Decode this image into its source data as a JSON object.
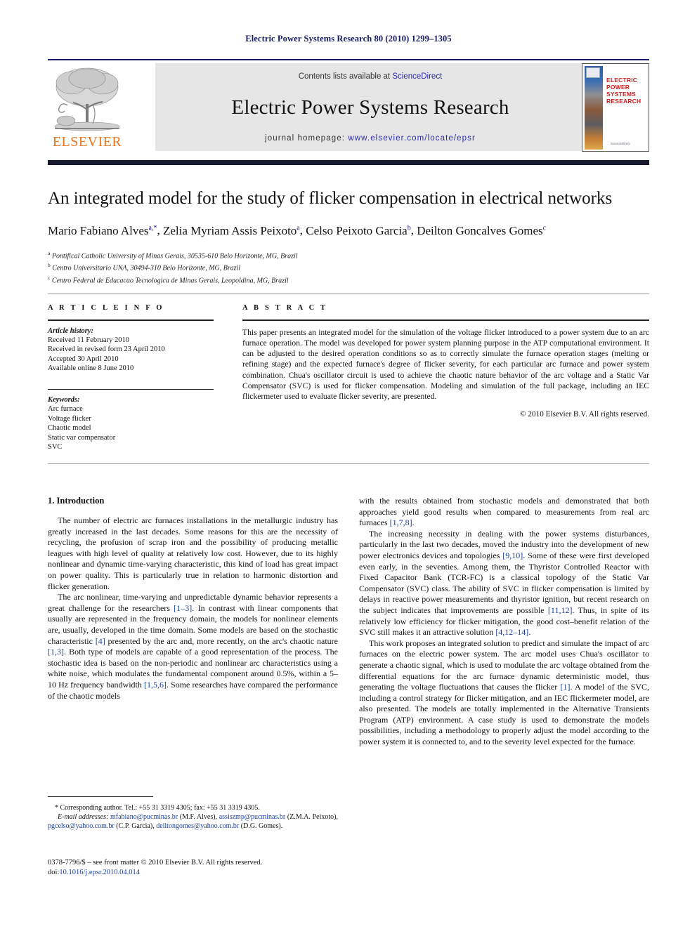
{
  "running_head": "Electric Power Systems Research 80 (2010) 1299–1305",
  "banner": {
    "contents_prefix": "Contents lists available at ",
    "sciencedirect": "ScienceDirect",
    "journal_title": "Electric Power Systems Research",
    "homepage_prefix": "journal homepage: ",
    "homepage_url": "www.elsevier.com/locate/epsr",
    "publisher_logo_text": "ELSEVIER",
    "publisher_logo_color": "#E87722",
    "link_color": "#2b2bb0",
    "cover": {
      "title_line1": "ELECTRIC POWER",
      "title_line2": "SYSTEMS RESEARCH",
      "title_color": "#cc2020",
      "footer": "ScienceDirect"
    }
  },
  "article": {
    "title": "An integrated model for the study of flicker compensation in electrical networks",
    "authors": [
      {
        "name": "Mario Fabiano Alves",
        "marks": "a,*"
      },
      {
        "name": "Zelia Myriam Assis Peixoto",
        "marks": "a"
      },
      {
        "name": "Celso Peixoto Garcia",
        "marks": "b"
      },
      {
        "name": "Deilton Goncalves Gomes",
        "marks": "c"
      }
    ],
    "affiliations": [
      {
        "mark": "a",
        "text": "Pontifical Catholic University of Minas Gerais, 30535-610 Belo Horizonte, MG, Brazil"
      },
      {
        "mark": "b",
        "text": "Centro Universitario UNA, 30494-310 Belo Horizonte, MG, Brazil"
      },
      {
        "mark": "c",
        "text": "Centro Federal de Educacao Tecnologica de Minas Gerais, Leopoldina, MG, Brazil"
      }
    ]
  },
  "article_info": {
    "label": "A R T I C L E    I N F O",
    "history_heading": "Article history:",
    "history": [
      "Received 11 February 2010",
      "Received in revised form 23 April 2010",
      "Accepted 30 April 2010",
      "Available online 8 June 2010"
    ],
    "keywords_heading": "Keywords:",
    "keywords": [
      "Arc furnace",
      "Voltage flicker",
      "Chaotic model",
      "Static var compensator",
      "SVC"
    ]
  },
  "abstract": {
    "label": "A B S T R A C T",
    "text": "This paper presents an integrated model for the simulation of the voltage flicker introduced to a power system due to an arc furnace operation. The model was developed for power system planning purpose in the ATP computational environment. It can be adjusted to the desired operation conditions so as to correctly simulate the furnace operation stages (melting or refining stage) and the expected furnace's degree of flicker severity, for each particular arc furnace and power system combination. Chua's oscillator circuit is used to achieve the chaotic nature behavior of the arc voltage and a Static Var Compensator (SVC) is used for flicker compensation. Modeling and simulation of the full package, including an IEC flickermeter used to evaluate flicker severity, are presented.",
    "copyright": "© 2010 Elsevier B.V. All rights reserved."
  },
  "body": {
    "section1_heading": "1.  Introduction",
    "left_paragraphs": [
      "The number of electric arc furnaces installations in the metallurgic industry has greatly increased in the last decades. Some reasons for this are the necessity of recycling, the profusion of scrap iron and the possibility of producing metallic leagues with high level of quality at relatively low cost. However, due to its highly nonlinear and dynamic time-varying characteristic, this kind of load has great impact on power quality. This is particularly true in relation to harmonic distortion and flicker generation."
    ],
    "left_paragraph2_parts": [
      "The arc nonlinear, time-varying and unpredictable dynamic behavior represents a great challenge for the researchers ",
      "[1–3]",
      ". In contrast with linear components that usually are represented in the frequency domain, the models for nonlinear elements are, usually, developed in the time domain. Some models are based on the stochastic characteristic ",
      "[4]",
      " presented by the arc and, more recently, on the arc's chaotic nature ",
      "[1,3]",
      ". Both type of models are capable of a good representation of the process. The stochastic idea is based on the non-periodic and nonlinear arc characteristics using a white noise, which modulates the fundamental component around 0.5%, within a 5–10 Hz frequency bandwidth ",
      "[1,5,6]",
      ". Some researches have compared the performance of the chaotic models"
    ],
    "right_paragraph1_parts": [
      "with the results obtained from stochastic models and demonstrated that both approaches yield good results when compared to measurements from real arc furnaces ",
      "[1,7,8]",
      "."
    ],
    "right_paragraph2_parts": [
      "The increasing necessity in dealing with the power systems disturbances, particularly in the last two decades, moved the industry into the development of new power electronics devices and topologies ",
      "[9,10]",
      ". Some of these were first developed even early, in the seventies. Among them, the Thyristor Controlled Reactor with Fixed Capacitor Bank (TCR-FC) is a classical topology of the Static Var Compensator (SVC) class. The ability of SVC in flicker compensation is limited by delays in reactive power measurements and thyristor ignition, but recent research on the subject indicates that improvements are possible ",
      "[11,12]",
      ". Thus, in spite of its relatively low efficiency for flicker mitigation, the good cost–benefit relation of the SVC still makes it an attractive solution ",
      "[4,12–14]",
      "."
    ],
    "right_paragraph3_parts": [
      "This work proposes an integrated solution to predict and simulate the impact of arc furnaces on the electric power system. The arc model uses Chua's oscillator to generate a chaotic signal, which is used to modulate the arc voltage obtained from the differential equations for the arc furnace dynamic deterministic model, thus generating the voltage fluctuations that causes the flicker ",
      "[1]",
      ". A model of the SVC, including a control strategy for flicker mitigation, and an IEC flickermeter model, are also presented. The models are totally implemented in the Alternative Transients Program (ATP) environment. A case study is used to demonstrate the models possibilities, including a methodology to properly adjust the model according to the power system it is connected to, and to the severity level expected for the furnace."
    ]
  },
  "footnotes": {
    "corresponding": "* Corresponding author. Tel.: +55 31 3319 4305; fax: +55 31 3319 4305.",
    "email_label": "E-mail addresses:",
    "emails": [
      {
        "address": "mfabiano@pucminas.br",
        "owner": "(M.F. Alves)"
      },
      {
        "address": "assiszmp@pucminas.br",
        "owner": "(Z.M.A. Peixoto)"
      },
      {
        "address": "pgcelso@yahoo.com.br",
        "owner": "(C.P. Garcia)"
      },
      {
        "address": "deiltongomes@yahoo.com.br",
        "owner": "(D.G. Gomes)"
      }
    ]
  },
  "imprint": {
    "front_matter": "0378-7796/$ – see front matter © 2010 Elsevier B.V. All rights reserved.",
    "doi_label": "doi:",
    "doi_value": "10.1016/j.epsr.2010.04.014"
  }
}
